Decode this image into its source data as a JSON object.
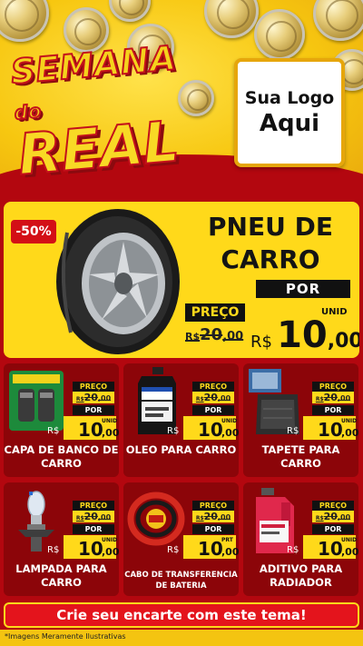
{
  "header": {
    "title_line1": "SEMANA",
    "title_connector": "do",
    "title_line2": "REAL",
    "logo_line1": "Sua Logo",
    "logo_line2": "Aqui"
  },
  "hero": {
    "discount": "-50%",
    "name_line1": "PNEU DE",
    "name_line2": "CARRO",
    "por_label": "POR",
    "preco_label": "PREÇO",
    "old_currency": "R$",
    "old_int": "20",
    "old_dec": ",00",
    "unid_label": "UNID",
    "new_currency": "R$",
    "new_int": "10",
    "new_dec": ",00"
  },
  "products": [
    {
      "label": "CAPA DE BANCO DE CARRO",
      "preco_label": "PREÇO",
      "old_currency": "R$",
      "old_int": "20",
      "old_dec": ",00",
      "por_label": "POR",
      "new_currency": "R$",
      "new_int": "10",
      "new_dec": ",00",
      "unit": "UNID"
    },
    {
      "label": "OLEO PARA CARRO",
      "preco_label": "PREÇO",
      "old_currency": "R$",
      "old_int": "20",
      "old_dec": ",00",
      "por_label": "POR",
      "new_currency": "R$",
      "new_int": "10",
      "new_dec": ",00",
      "unit": "UNID"
    },
    {
      "label": "TAPETE PARA CARRO",
      "preco_label": "PREÇO",
      "old_currency": "R$",
      "old_int": "20",
      "old_dec": ",00",
      "por_label": "POR",
      "new_currency": "R$",
      "new_int": "10",
      "new_dec": ",00",
      "unit": "UNID"
    },
    {
      "label": "LAMPADA PARA CARRO",
      "preco_label": "PREÇO",
      "old_currency": "R$",
      "old_int": "20",
      "old_dec": ",00",
      "por_label": "POR",
      "new_currency": "R$",
      "new_int": "10",
      "new_dec": ",00",
      "unit": "UNID"
    },
    {
      "label": "CABO DE TRANSFERENCIA DE BATERIA",
      "preco_label": "PREÇO",
      "old_currency": "R$",
      "old_int": "20",
      "old_dec": ",00",
      "por_label": "POR",
      "new_currency": "R$",
      "new_int": "10",
      "new_dec": ",00",
      "unit": "PRT"
    },
    {
      "label": "ADITIVO PARA RADIADOR",
      "preco_label": "PREÇO",
      "old_currency": "R$",
      "old_int": "20",
      "old_dec": ",00",
      "por_label": "POR",
      "new_currency": "R$",
      "new_int": "10",
      "new_dec": ",00",
      "unit": "UNID"
    }
  ],
  "footer": {
    "cta": "Crie seu encarte com este tema!",
    "disclaimer": "*Imagens Meramente Ilustrativas"
  },
  "colors": {
    "brand_red": "#b3070f",
    "card_red": "#8c0509",
    "yellow": "#ffd91a"
  }
}
